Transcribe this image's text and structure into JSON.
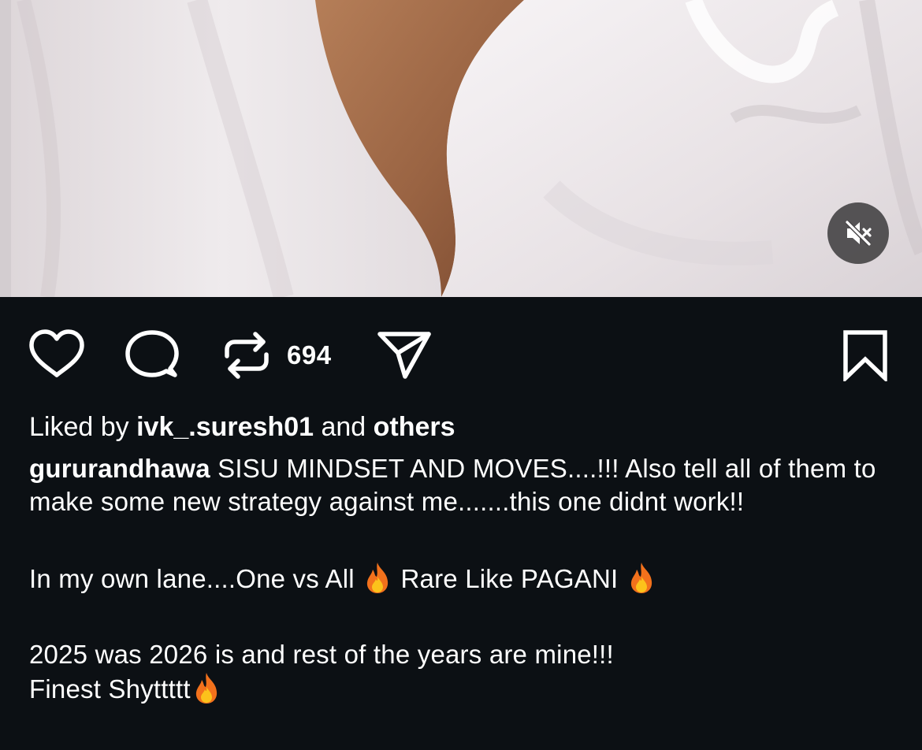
{
  "media": {
    "mute_icon": "speaker-muted-icon"
  },
  "actions": {
    "like_icon": "heart-icon",
    "comment_icon": "comment-bubble-icon",
    "repost_icon": "repost-icon",
    "repost_count": "694",
    "share_icon": "paper-plane-icon",
    "save_icon": "bookmark-icon"
  },
  "likes": {
    "prefix": "Liked by ",
    "user": "ivk_.suresh01",
    "middle": " and ",
    "others": "others"
  },
  "caption": {
    "username": "gururandhawa",
    "line1": " SISU MINDSET AND MOVES....!!! Also tell all of them to make some new strategy against me.......this one didnt work!!",
    "line2_part1": "In my own lane....One vs All ",
    "line2_part2": " Rare Like PAGANI ",
    "line3": "2025 was 2026 is and rest of the years are mine!!!",
    "line4": "Finest Shyttttt",
    "emoji_icon": "fire-emoji-icon"
  }
}
